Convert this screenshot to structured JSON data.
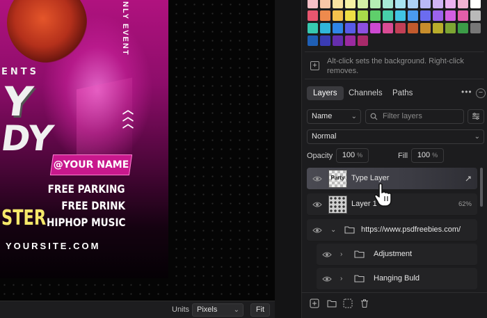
{
  "poster": {
    "ents": "ENTS",
    "letter_y": "Y",
    "letter_dy": "DY",
    "vertical_text": "NLY EVENT",
    "chevrons": "︿︿︿",
    "name_badge": "@YOUR NAME",
    "features": [
      "FREE PARKING",
      "FREE DRINK",
      "HIPHOP MUSIC"
    ],
    "ster": "STER",
    "website": "YOURSITE.COM"
  },
  "statusbar": {
    "units_label": "Units",
    "units_value": "Pixels",
    "fit_label": "Fit"
  },
  "swatch_colors": [
    [
      "#f7c0c7",
      "#f9c6a7",
      "#fbe3a1",
      "#f6f1a4",
      "#d4f1a6",
      "#b5ecb3",
      "#a8e9d6",
      "#a8e4f1",
      "#acd1f5",
      "#b9b9f6",
      "#d0b5f5",
      "#ebb2ef",
      "#f2b3d3",
      "#ffffff"
    ],
    [
      "#e8566f",
      "#ee8a4d",
      "#f4c24d",
      "#eedf45",
      "#a9dc4a",
      "#5fcf6b",
      "#47cfa9",
      "#41c4e4",
      "#4a9af0",
      "#6b6cf0",
      "#9c63ee",
      "#d35fe2",
      "#e35ea9",
      "#b9b9b9"
    ],
    [
      "#37c9b0",
      "#30b6da",
      "#2f86e6",
      "#575be7",
      "#8c50e0",
      "#cc49d1",
      "#d94b94",
      "#c23f56",
      "#c25a2d",
      "#c78d2c",
      "#b9ad2b",
      "#7da533",
      "#3b9c47",
      "#777777"
    ],
    [
      "#1f5fb5",
      "#3a3bb3",
      "#652eae",
      "#9a2aa0",
      "#a82a6a"
    ]
  ],
  "bg_hint": "Alt-click sets the background. Right-click removes.",
  "tabs": [
    {
      "label": "Layers",
      "active": true
    },
    {
      "label": "Channels",
      "active": false
    },
    {
      "label": "Paths",
      "active": false
    }
  ],
  "more_icon": "•••",
  "collapse_icon": "−",
  "filter": {
    "kind": "Name",
    "placeholder": "Filter layers"
  },
  "blend_mode": "Normal",
  "opacity": {
    "label": "Opacity",
    "value": "100",
    "unit": "%"
  },
  "fill": {
    "label": "Fill",
    "value": "100",
    "unit": "%"
  },
  "layers": [
    {
      "name": "Type Layer",
      "thumb_text": "Party",
      "selected": true,
      "meta": ""
    },
    {
      "name": "Layer 1",
      "thumb_text": "",
      "selected": false,
      "meta": "62%"
    },
    {
      "name": "https://www.psdfreebies.com/",
      "type": "group",
      "selected": false,
      "meta": ""
    },
    {
      "name": "Adjustment",
      "type": "group",
      "selected": false,
      "meta": ""
    },
    {
      "name": "Hanging Buld",
      "type": "group",
      "selected": false,
      "meta": ""
    }
  ],
  "icons": {
    "visibility": "eye-icon",
    "folder": "folder-icon",
    "caret": "chevron-right-icon",
    "cursor": "hand-pointer-icon"
  }
}
